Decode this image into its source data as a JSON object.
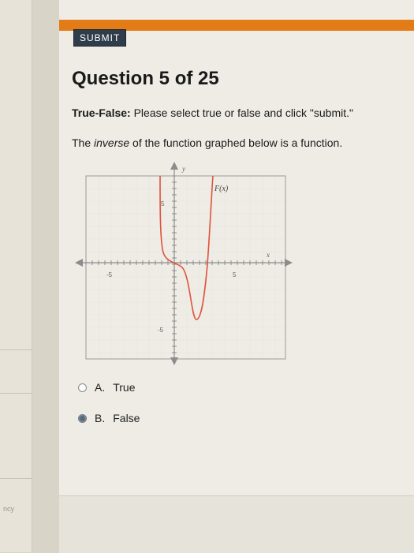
{
  "sidebar": {
    "stub_text": "ncy"
  },
  "toolbar": {
    "submit_label": "SUBMIT"
  },
  "question": {
    "title": "Question 5 of 25",
    "instructions_lead": "True-False:",
    "instructions_rest": " Please select true or false and click \"submit.\"",
    "prompt_before": "The ",
    "prompt_emphasis": "inverse",
    "prompt_after": " of the function graphed below is a function."
  },
  "graph": {
    "x_axis_label": "x",
    "y_axis_label": "y",
    "function_label": "F(x)",
    "x_tick_neg": "-5",
    "x_tick_pos": "5",
    "y_tick_pos": "5",
    "y_tick_neg": "-5",
    "curve_color": "#e0533a",
    "axis_color": "#8c8c8c"
  },
  "choices": [
    {
      "letter": "A.",
      "label": "True",
      "selected": false
    },
    {
      "letter": "B.",
      "label": "False",
      "selected": true
    }
  ],
  "colors": {
    "accent": "#e37b17",
    "button": "#2f3d4b"
  }
}
